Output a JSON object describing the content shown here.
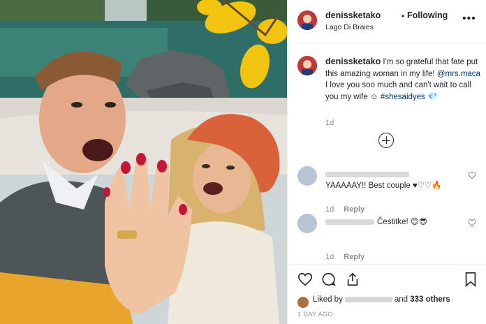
{
  "post": {
    "username": "denissketako",
    "follow_status": "Following",
    "location": "Lago Di Braies",
    "more_icon": "more-options-icon",
    "more_label": "•••"
  },
  "caption": {
    "username": "denissketako",
    "text_part1": " I'm so grateful that fate put this amazing woman in my life! ",
    "mention": "@mrs.maca",
    "text_part2": " I love you soo much and can't wait to call you my wife ",
    "emoji1": "☺",
    "hashtag": "#shesaidyes",
    "emoji2": "💎",
    "timestamp": "1d"
  },
  "comments": [
    {
      "text": "YAAAAAY!! Best couple ♥♡♡🔥",
      "timestamp": "1d",
      "reply_label": "Reply"
    },
    {
      "text": "Čestitke! 😊😎",
      "timestamp": "1d",
      "reply_label": "Reply"
    }
  ],
  "likes": {
    "prefix": "Liked by",
    "middle": "and",
    "count_text": "333 others"
  },
  "date_label": "1 DAY AGO",
  "colors": {
    "link": "#003569",
    "muted": "#8e8e8e",
    "text": "#262626",
    "border": "#efefef"
  }
}
